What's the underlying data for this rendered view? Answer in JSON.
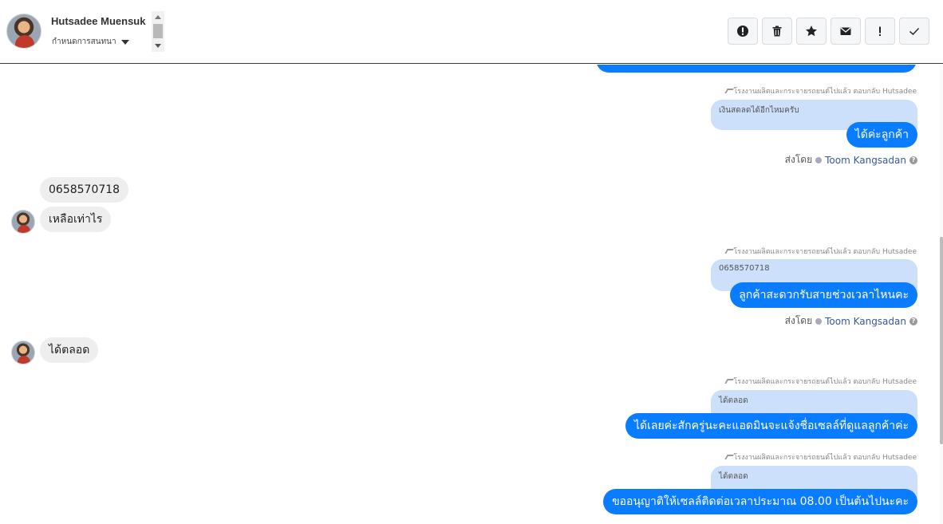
{
  "header": {
    "contact_name": "Hutsadee Muensuk",
    "label_select": "กำหนดการสนทนา",
    "actions": [
      {
        "icon": "exclamation-circle-icon",
        "label": "Mark as spam"
      },
      {
        "icon": "trash-icon",
        "label": "Delete"
      },
      {
        "icon": "star-icon",
        "label": "Star"
      },
      {
        "icon": "envelope-icon",
        "label": "Mark as unread"
      },
      {
        "icon": "exclamation-icon",
        "label": "Follow up"
      },
      {
        "icon": "check-icon",
        "label": "Done"
      }
    ]
  },
  "messages": {
    "m1": {
      "reply_meta": "โรงงานผลิตและกระจายรถยนต์ไปแล้ว ตอบกลับ Hutsadee",
      "quote": "เงินสดลดได้อีกไหมครับ",
      "text": "ได้ค่ะลูกค้า",
      "sent_by_label": "ส่งโดย",
      "agent": "Toom Kangsadan"
    },
    "m2": {
      "text": "0658570718"
    },
    "m3": {
      "text": "เหลือเท่าไร"
    },
    "m4": {
      "reply_meta": "โรงงานผลิตและกระจายรถยนต์ไปแล้ว ตอบกลับ Hutsadee",
      "quote": "0658570718",
      "text": "ลูกค้าสะดวกรับสายช่วงเวลาไหนคะ",
      "sent_by_label": "ส่งโดย",
      "agent": "Toom Kangsadan"
    },
    "m5": {
      "text": "ได้ตลอด"
    },
    "m6": {
      "reply_meta": "โรงงานผลิตและกระจายรถยนต์ไปแล้ว ตอบกลับ Hutsadee",
      "quote": "ได้ตลอด",
      "text": "ได้เลยค่ะสักครู่นะคะแอดมินจะแจ้งชื่อเซลล์ที่ดูแลลูกค้าค่ะ"
    },
    "m7": {
      "reply_meta": "โรงงานผลิตและกระจายรถยนต์ไปแล้ว ตอบกลับ Hutsadee",
      "quote": "ได้ตลอด",
      "text": "ขออนุญาติให้เซลล์ติดต่อเวลาประมาณ 08.00 เป็นต้นไปนะคะ"
    }
  },
  "colors": {
    "outgoing_bubble": "#0a7cff",
    "incoming_bubble": "#eeeeee",
    "quote_bubble": "#cce0fb",
    "agent_link": "#385898"
  }
}
